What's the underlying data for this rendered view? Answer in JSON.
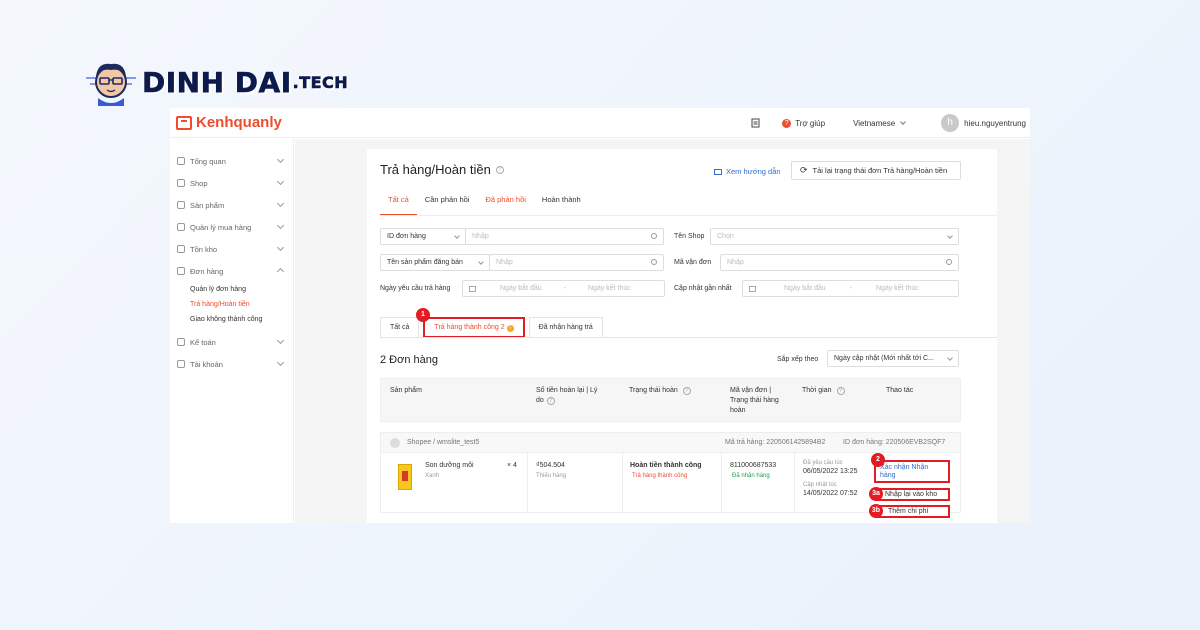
{
  "brand": {
    "name": "DINH DAI",
    "suffix": ".TECH"
  },
  "app": {
    "logo": "Kenhquanly",
    "help": "Trợ giúp",
    "language": "Vietnamese",
    "avatar_letter": "h",
    "username": "hieu.nguyentrung"
  },
  "sidebar": {
    "items": [
      {
        "label": "Tổng quan"
      },
      {
        "label": "Shop"
      },
      {
        "label": "Sản phẩm"
      },
      {
        "label": "Quản lý mua hàng"
      },
      {
        "label": "Tồn kho"
      },
      {
        "label": "Đơn hàng"
      },
      {
        "label": "Kế toán"
      },
      {
        "label": "Tài khoản"
      }
    ],
    "subitems": [
      {
        "label": "Quản lý đơn hàng"
      },
      {
        "label": "Trả hàng/Hoàn tiền"
      },
      {
        "label": "Giao không thành công"
      }
    ]
  },
  "page": {
    "title": "Trả hàng/Hoàn tiền",
    "guide_link": "Xem hướng dẫn",
    "reload_button": "Tải lại trạng thái đơn Trả hàng/Hoàn tiền",
    "tabs": [
      "Tất cả",
      "Cần phản hồi",
      "Đã phản hồi",
      "Hoàn thành"
    ]
  },
  "filters": {
    "order_id_select": "ID đơn hàng",
    "order_id_placeholder": "Nhập",
    "shop_label": "Tên Shop",
    "shop_placeholder": "Chọn",
    "product_select": "Tên sản phẩm đăng bán",
    "product_placeholder": "Nhập",
    "tracking_label": "Mã vận đơn",
    "tracking_placeholder": "Nhập",
    "request_date_label": "Ngày yêu cầu trả hàng",
    "updated_label": "Cập nhật gần nhất",
    "start_date": "Ngày bắt đầu",
    "end_date": "Ngày kết thúc",
    "date_sep": "-"
  },
  "sub_tabs": {
    "all": "Tất cả",
    "success": "Trả hàng thành công 2",
    "received": "Đã nhận hàng trả"
  },
  "list": {
    "count_label": "2 Đơn hàng",
    "sort_label": "Sắp xếp theo",
    "sort_value": "Ngày cập nhật (Mới nhất tới C..."
  },
  "table": {
    "headers": {
      "product": "Sản phẩm",
      "refund_line1": "Số tiền hoàn lại  |  Lý",
      "refund_line2": "do",
      "refund_status": "Trạng thái hoàn",
      "tracking_line1": "Mã vận đơn |",
      "tracking_line2": "Trạng thái hàng",
      "tracking_line3": "hoàn",
      "time": "Thời gian",
      "action": "Thao tác"
    }
  },
  "order": {
    "shop": "Shopee / wmslite_test5",
    "return_id": "Mã trả hàng: 2205061425894B2",
    "order_id": "ID đơn hàng: 220506EVB2SQF7",
    "product_name": "Son dưỡng môi",
    "product_variant": "Xanh",
    "quantity": "× 4",
    "refund_amount": "₫504.504",
    "refund_reason": "Thiếu hàng",
    "refund_status": "Hoàn tiền thành công",
    "return_status": "Trả hàng thành công",
    "tracking_no": "811000687533",
    "tracking_status": "Đã nhận hàng",
    "requested_label": "Đã yêu cầu lúc",
    "requested_time": "06/05/2022 13:25",
    "updated_label": "Cập nhật lúc",
    "updated_time": "14/05/2022 07:52",
    "action_confirm_line1": "Xác nhận Nhận",
    "action_confirm_line2": "hàng",
    "action_restock": "Nhập lại vào kho",
    "action_add_fee": "Thêm chi phí"
  },
  "annotations": [
    "1",
    "2",
    "3a",
    "3b"
  ]
}
